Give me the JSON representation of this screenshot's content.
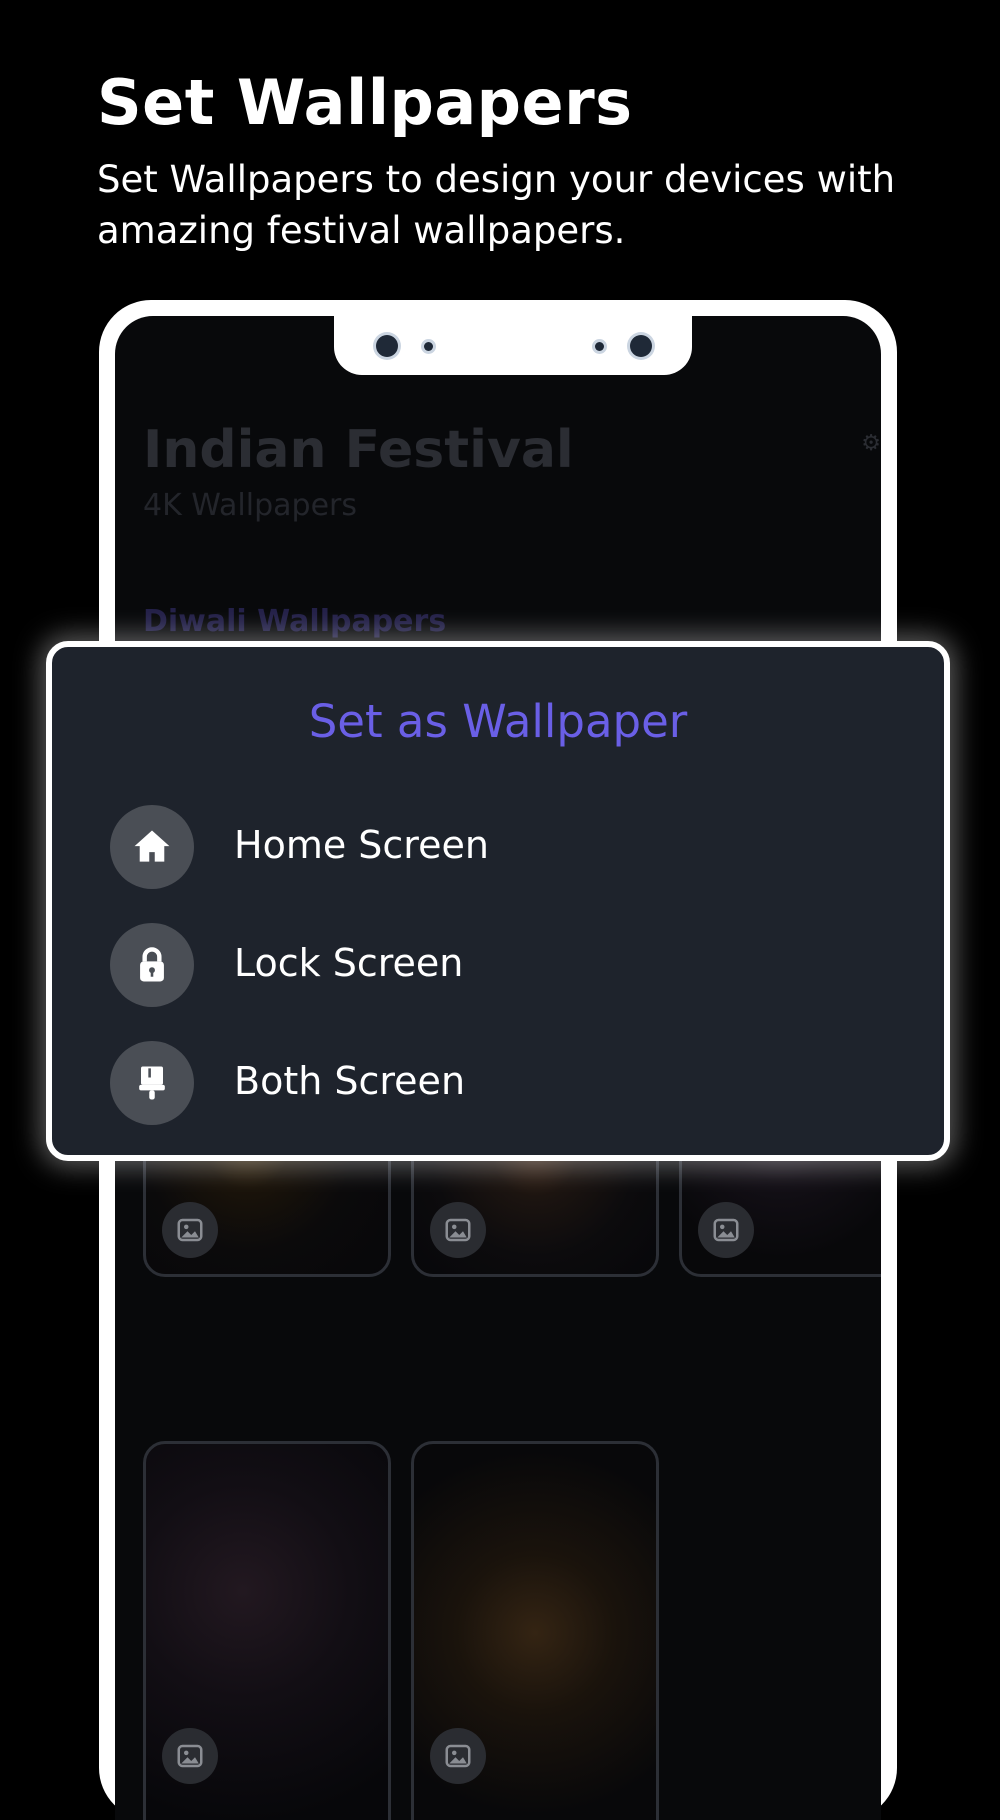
{
  "header": {
    "title": "Set Wallpapers",
    "subtitle": "Set Wallpapers to design your devices with amazing festival wallpapers."
  },
  "app": {
    "title": "Indian Festival",
    "subtitle": "4K Wallpapers",
    "section": "Diwali Wallpapers"
  },
  "dialog": {
    "title": "Set as Wallpaper",
    "title_color": "#6a5fe6",
    "options": [
      {
        "label": "Home Screen",
        "icon": "home-icon"
      },
      {
        "label": "Lock Screen",
        "icon": "lock-icon"
      },
      {
        "label": "Both Screen",
        "icon": "brush-icon"
      }
    ]
  },
  "wallpapers": [
    {
      "icon": "image-icon"
    },
    {
      "icon": "image-icon"
    },
    {
      "icon": "image-icon"
    },
    {
      "icon": "image-icon"
    },
    {
      "icon": "image-icon"
    }
  ]
}
